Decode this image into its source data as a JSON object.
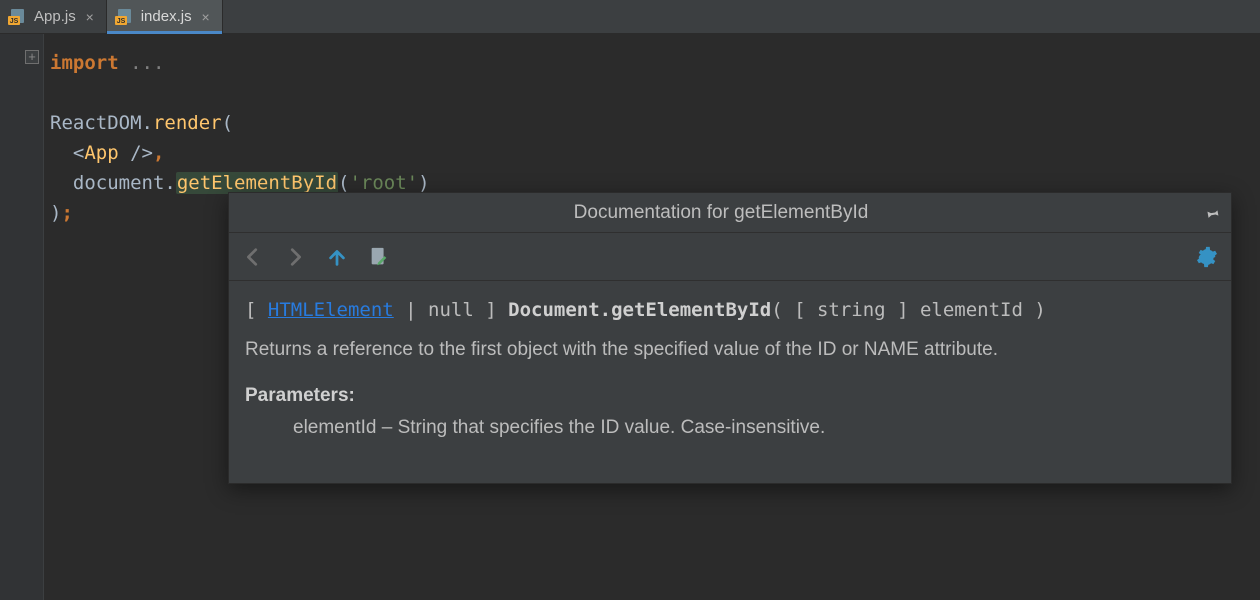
{
  "tabs": [
    {
      "label": "App.js",
      "active": false
    },
    {
      "label": "index.js",
      "active": true
    }
  ],
  "fold_marker": "+",
  "code": {
    "line1_kw": "import",
    "line1_rest": "...",
    "line3_a": "ReactDOM",
    "line3_b": "render",
    "line4_tag": "App",
    "line5_a": "document",
    "line5_b": "getElementById",
    "line5_str": "'root'"
  },
  "doc": {
    "title": "Documentation for getElementById",
    "sig_open": "[ ",
    "sig_link": "HTMLElement",
    "sig_mid1": " | null ] ",
    "sig_bold": "Document.getElementById",
    "sig_mid2": "( [ string ] elementId )",
    "description": "Returns a reference to the first object with the specified value of the ID or NAME attribute.",
    "params_heading": "Parameters:",
    "param1": "elementId – String that specifies the ID value. Case-insensitive."
  }
}
